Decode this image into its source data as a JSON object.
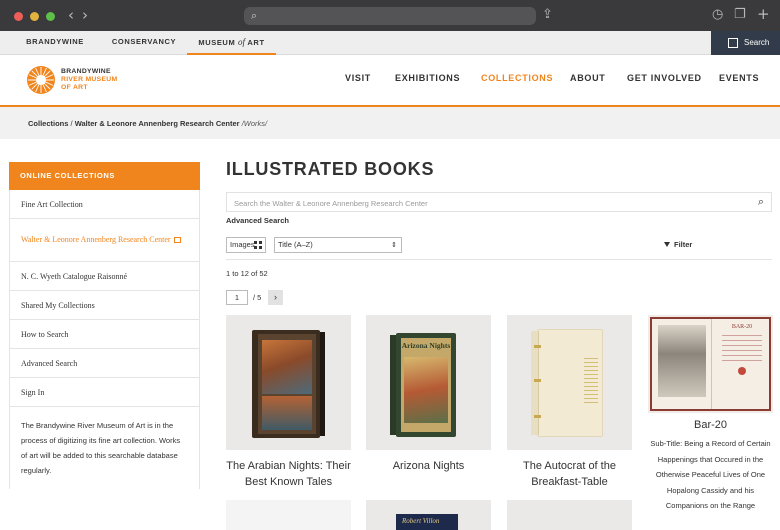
{
  "topnav": {
    "tabs": [
      {
        "label": "BRANDYWINE"
      },
      {
        "label": "CONSERVANCY"
      },
      {
        "label_a": "MUSEUM",
        "label_b": "of",
        "label_c": "ART"
      }
    ],
    "search_label": "Search"
  },
  "logo": {
    "line1": "BRANDYWINE",
    "line2": "RIVER MUSEUM",
    "line3": "OF ART"
  },
  "mainnav": [
    "VISIT",
    "EXHIBITIONS",
    "COLLECTIONS",
    "ABOUT",
    "GET INVOLVED",
    "EVENTS"
  ],
  "breadcrumb": {
    "item1": "Collections",
    "sep1": " / ",
    "item2": "Walter & Leonore Annenberg Research Center",
    "item3": " /Works/"
  },
  "sidebar": {
    "heading": "ONLINE COLLECTIONS",
    "items": [
      {
        "label": "Fine Art Collection"
      },
      {
        "label": "Walter & Leonore Annenberg Research Center"
      },
      {
        "label": "N. C. Wyeth Catalogue Raisonné"
      },
      {
        "label": "Shared My Collections"
      },
      {
        "label": "How to Search"
      },
      {
        "label": "Advanced Search"
      },
      {
        "label": "Sign In"
      }
    ],
    "note": "The Brandywine River Museum of Art is in the process of digitizing its fine art collection. Works of art will be added to this searchable database regularly."
  },
  "main": {
    "title": "ILLUSTRATED BOOKS",
    "search_placeholder": "Search the Walter & Leonore Annenberg Research Center",
    "advanced_search": "Advanced Search",
    "view_label": "Images",
    "sort_value": "Title (A–Z)",
    "filter_label": "Filter",
    "result_count": "1 to 12 of 52",
    "page_current": "1",
    "page_total": "/ 5",
    "cards": [
      {
        "title": "The Arabian Nights: Their Best Known Tales",
        "cover_text": ""
      },
      {
        "title": "Arizona Nights",
        "cover_text": "Arizona Nights"
      },
      {
        "title": "The Autocrat of the Breakfast-Table",
        "cover_text": ""
      },
      {
        "title": "Bar-20",
        "subtitle": "Sub-Title: Being a Record of Certain Happenings that Occured in the Otherwise Peaceful Lives of One Hopalong Cassidy and his Companions on the Range",
        "cover_text": "BAR-20"
      }
    ],
    "row2_cover_text": "Robert Villon"
  },
  "colors": {
    "accent": "#f0851e",
    "search_bg": "#323b4a"
  }
}
